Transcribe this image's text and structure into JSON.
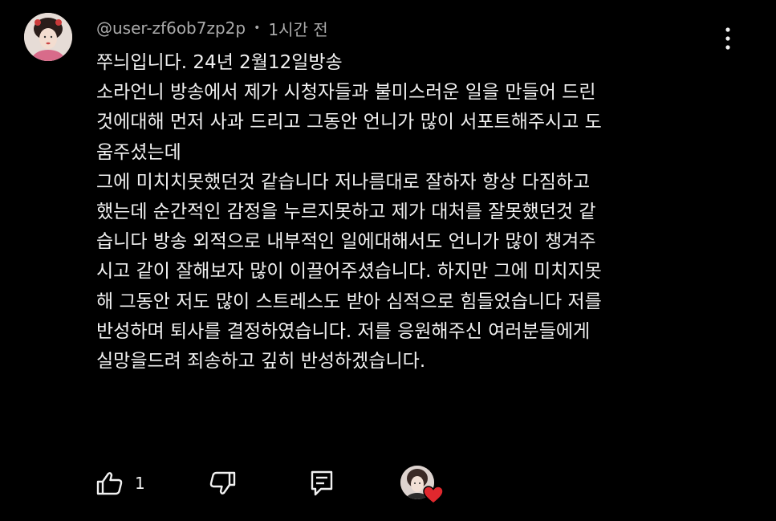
{
  "comment": {
    "author": "@user-zf6ob7zp2p",
    "separator": "•",
    "time": "1시간 전",
    "lines": [
      "쭈늬입니다. 24년 2월12일방송",
      "소라언니 방송에서 제가 시청자들과  불미스러운 일을 만들어 드린",
      "것에대해 먼저 사과 드리고 그동안 언니가  많이 서포트해주시고 도",
      "움주셨는데",
      "그에 미치치못했던것 같습니다 저나름대로 잘하자 항상 다짐하고",
      "했는데 순간적인 감정을 누르지못하고 제가 대처를 잘못했던것 같",
      "습니다 방송 외적으로 내부적인  일에대해서도 언니가 많이 챙겨주",
      "시고 같이 잘해보자 많이 이끌어주셨습니다. 하지만 그에 미치지못",
      "해 그동안 저도 많이 스트레스도 받아 심적으로 힘들었습니다 저를",
      "반성하며  퇴사를 결정하였습니다. 저를 응원해주신 여러분들에게",
      "실망을드려 죄송하고 깊히 반성하겠습니다."
    ]
  },
  "actions": {
    "like_count": "1"
  },
  "icons": {
    "more": "more-vertical-icon",
    "like": "thumbs-up-icon",
    "dislike": "thumbs-down-icon",
    "reply": "reply-comment-icon",
    "heart": "creator-heart-icon"
  },
  "colors": {
    "background": "#000000",
    "text": "#f1f1f1",
    "meta": "#aaaaaa",
    "heart": "#e0282e"
  }
}
